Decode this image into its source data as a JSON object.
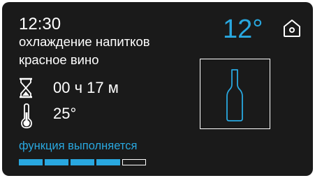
{
  "header": {
    "time": "12:30",
    "program": "охлаждение напитков",
    "subprogram": "красное вино",
    "target_temperature": "12°"
  },
  "icons": {
    "home": "home-icon",
    "timer": "hourglass-icon",
    "temperature": "thermometer-icon",
    "drink": "wine-bottle-icon"
  },
  "timer": {
    "value": "00 ч 17 м"
  },
  "temperature": {
    "value": "25°"
  },
  "status": {
    "text": "функция выполняется"
  },
  "progress": {
    "total_segments": 5,
    "filled_segments": 4
  },
  "colors": {
    "accent": "#29a8e0",
    "background": "#1a1a1a",
    "text": "#ffffff"
  }
}
